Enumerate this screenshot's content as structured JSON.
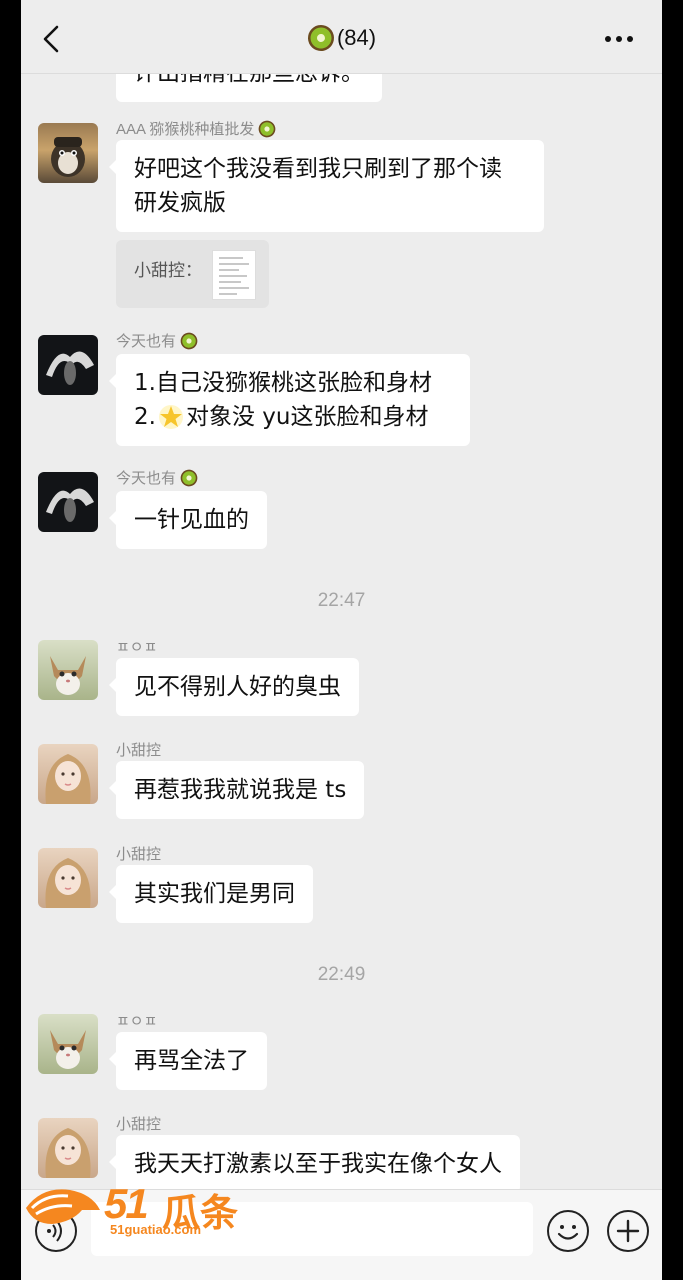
{
  "header": {
    "title_count": "(84)",
    "back_icon": "chevron-left-icon",
    "more_icon": "more-dots-icon"
  },
  "messages": [
    {
      "sender": "",
      "text": "评出指精在那些忠诉。",
      "partial": true
    },
    {
      "sender": "AAA 猕猴桃种植批发",
      "text_lines": [
        "好吧这个我没看到我只刷到了那个读",
        "研发疯版"
      ]
    },
    {
      "quote_label": "小甜控："
    },
    {
      "sender": "今天也有",
      "text_lines": [
        "1.自己没猕猴桃这张脸和身材",
        "2.",
        "对象没 yu这张脸和身材"
      ]
    },
    {
      "sender": "今天也有",
      "text": "一针见血的"
    },
    {
      "time": "22:47"
    },
    {
      "sender": "ㅍㅇㅍ",
      "text": "见不得别人好的臭虫"
    },
    {
      "sender": "小甜控",
      "text": "再惹我我就说我是 ts"
    },
    {
      "sender": "小甜控",
      "text": "其实我们是男同"
    },
    {
      "time": "22:49"
    },
    {
      "sender": "ㅍㅇㅍ",
      "text": "再骂全法了"
    },
    {
      "sender": "小甜控",
      "text": "我天天打激素以至于我实在像个女人"
    }
  ],
  "input": {
    "placeholder": ""
  },
  "watermark": {
    "num": "51",
    "brand": "瓜条",
    "url": "51guatiao.com"
  },
  "colors": {
    "background": "#ededed",
    "bubble": "#ffffff",
    "watermark": "#f5871f",
    "kiwi_skin": "#6b4b1f",
    "kiwi_flesh": "#8fbf2a"
  }
}
